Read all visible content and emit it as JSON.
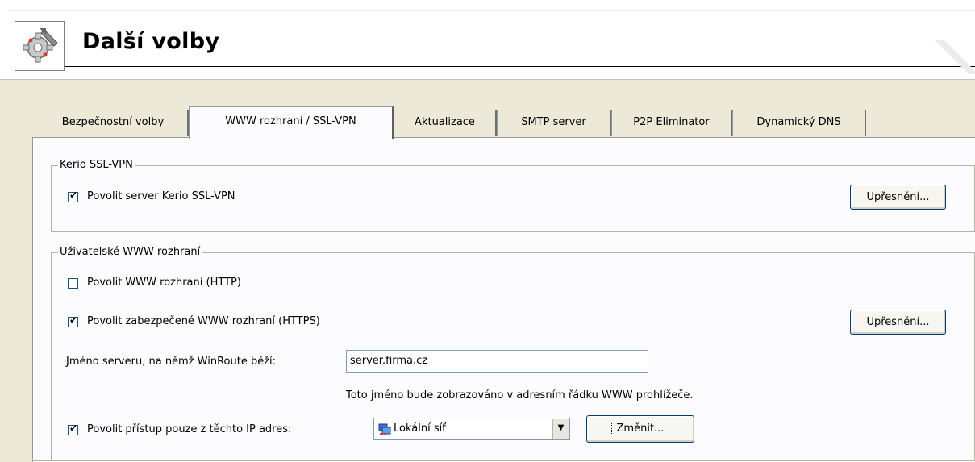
{
  "header": {
    "title": "Další volby",
    "icon": "settings-icon"
  },
  "tabs": [
    {
      "label": "Bezpečnostní volby"
    },
    {
      "label": "WWW rozhraní / SSL-VPN"
    },
    {
      "label": "Aktualizace"
    },
    {
      "label": "SMTP server"
    },
    {
      "label": "P2P Eliminator"
    },
    {
      "label": "Dynamický DNS"
    }
  ],
  "active_tab_index": 1,
  "ssl_vpn_group": {
    "title": "Kerio SSL-VPN",
    "enable_label": "Povolit server Kerio SSL-VPN",
    "enable_checked": true,
    "advanced_button": "Upřesnění..."
  },
  "web_group": {
    "title": "Uživatelské WWW rozhraní",
    "http_label": "Povolit WWW rozhraní (HTTP)",
    "http_checked": false,
    "https_label": "Povolit zabezpečené WWW rozhraní (HTTPS)",
    "https_checked": true,
    "advanced_button": "Upřesnění...",
    "server_name_label": "Jméno serveru, na němž WinRoute běží:",
    "server_name_value": "server.firma.cz",
    "server_name_hint": "Toto jméno bude zobrazováno v adresním řádku WWW prohlížeče.",
    "restrict_label": "Povolit přístup pouze z těchto IP adres:",
    "restrict_checked": true,
    "ip_group_selected": "Lokální síť",
    "change_button": "Změnit..."
  }
}
